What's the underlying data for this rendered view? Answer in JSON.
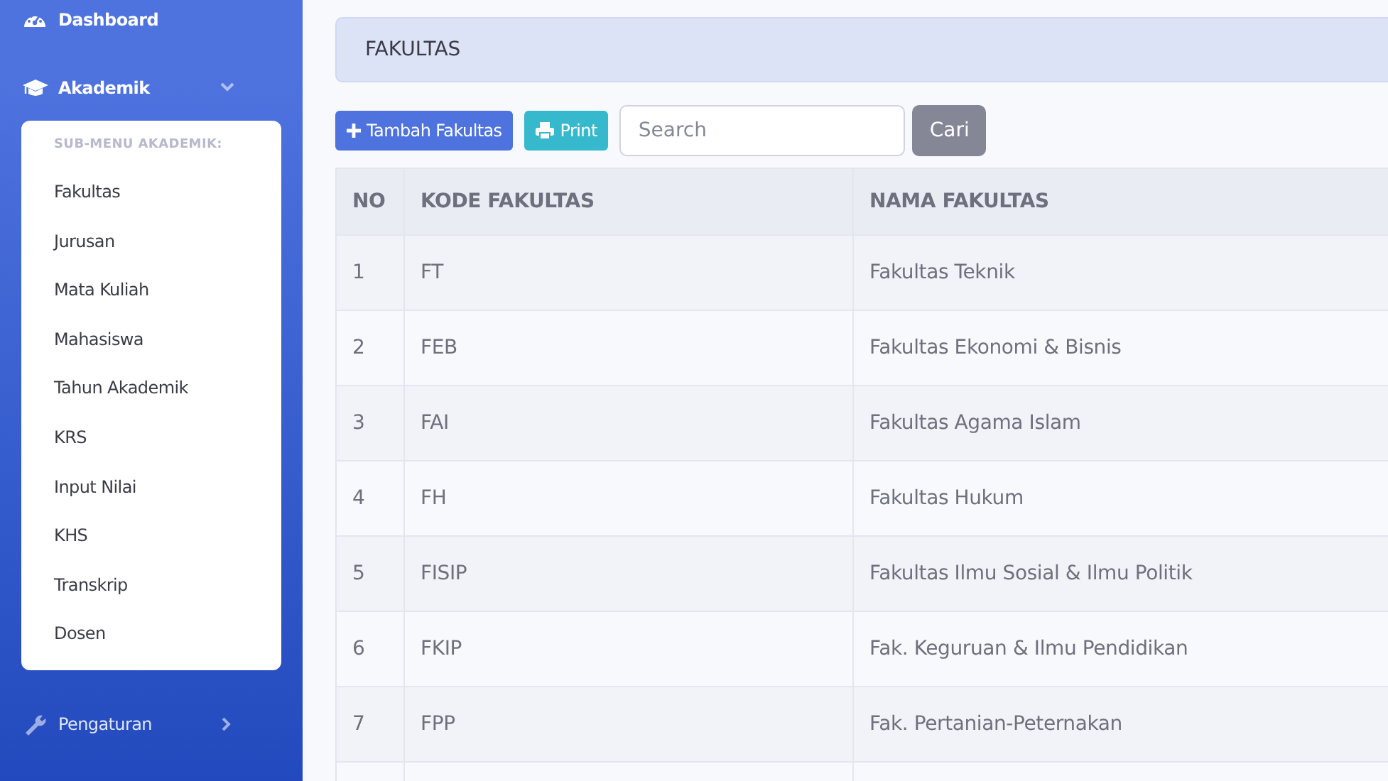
{
  "sidebar": {
    "items": [
      {
        "label": "Dashboard",
        "kind": "link"
      },
      {
        "label": "Akademik",
        "kind": "collapse",
        "expanded": true,
        "submenu": {
          "heading": "SUB-MENU AKADEMIK:",
          "items": [
            "Fakultas",
            "Jurusan",
            "Mata Kuliah",
            "Mahasiswa",
            "Tahun Akademik",
            "KRS",
            "Input Nilai",
            "KHS",
            "Transkrip",
            "Dosen"
          ]
        }
      },
      {
        "label": "Pengaturan",
        "kind": "collapse",
        "expanded": false
      }
    ]
  },
  "page_header": {
    "title": "FAKULTAS"
  },
  "toolbar": {
    "add_button": "Tambah Fakultas",
    "print_button": "Print",
    "search": {
      "placeholder": "Search"
    },
    "search_button": "Cari"
  },
  "table": {
    "columns": [
      "NO",
      "KODE FAKULTAS",
      "NAMA FAKULTAS"
    ],
    "rows": [
      [
        "1",
        "FT",
        "Fakultas Teknik"
      ],
      [
        "2",
        "FEB",
        "Fakultas Ekonomi & Bisnis"
      ],
      [
        "3",
        "FAI",
        "Fakultas Agama Islam"
      ],
      [
        "4",
        "FH",
        "Fakultas Hukum"
      ],
      [
        "5",
        "FISIP",
        "Fakultas Ilmu Sosial & Ilmu Politik"
      ],
      [
        "6",
        "FKIP",
        "Fak. Keguruan & Ilmu Pendidikan"
      ],
      [
        "7",
        "FPP",
        "Fak. Pertanian-Peternakan"
      ]
    ]
  }
}
